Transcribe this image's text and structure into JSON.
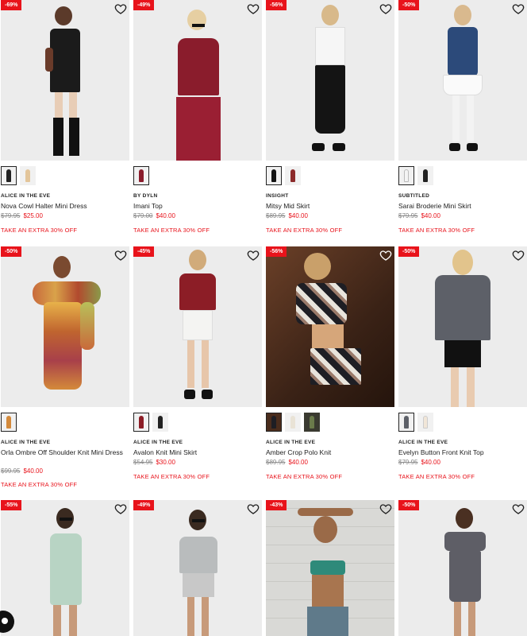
{
  "colors": {
    "sale_red": "#e8131b",
    "text_dark": "#222222",
    "strike_grey": "#888888"
  },
  "products": [
    {
      "badge": "-69%",
      "brand": "ALICE IN THE EVE",
      "name": "Nova Cowl Halter Mini Dress",
      "was": "$79.95",
      "now": "$25.00",
      "promo": "TAKE AN EXTRA 30% OFF",
      "swatches": 2
    },
    {
      "badge": "-49%",
      "brand": "BY DYLN",
      "name": "Imani Top",
      "was": "$79.00",
      "now": "$40.00",
      "promo": "TAKE AN EXTRA 30% OFF",
      "swatches": 1
    },
    {
      "badge": "-56%",
      "brand": "INSIGHT",
      "name": "Mitsy Mid Skirt",
      "was": "$89.95",
      "now": "$40.00",
      "promo": "TAKE AN EXTRA 30% OFF",
      "swatches": 2
    },
    {
      "badge": "-50%",
      "brand": "SUBTITLED",
      "name": "Sarai Broderie Mini Skirt",
      "was": "$79.95",
      "now": "$40.00",
      "promo": "TAKE AN EXTRA 30% OFF",
      "swatches": 2
    },
    {
      "badge": "-50%",
      "brand": "ALICE IN THE EVE",
      "name": "Orla Ombre Off Shoulder Knit Mini Dress",
      "was": "$99.95",
      "now": "$40.00",
      "promo": "TAKE AN EXTRA 30% OFF",
      "swatches": 1
    },
    {
      "badge": "-45%",
      "brand": "ALICE IN THE EVE",
      "name": "Avalon Knit Mini Skirt",
      "was": "$54.95",
      "now": "$30.00",
      "promo": "TAKE AN EXTRA 30% OFF",
      "swatches": 2
    },
    {
      "badge": "-56%",
      "brand": "ALICE IN THE EVE",
      "name": "Amber Crop Polo Knit",
      "was": "$89.95",
      "now": "$40.00",
      "promo": "TAKE AN EXTRA 30% OFF",
      "swatches": 3
    },
    {
      "badge": "-50%",
      "brand": "ALICE IN THE EVE",
      "name": "Evelyn Button Front Knit Top",
      "was": "$79.95",
      "now": "$40.00",
      "promo": "TAKE AN EXTRA 30% OFF",
      "swatches": 2
    },
    {
      "badge": "-55%"
    },
    {
      "badge": "-49%"
    },
    {
      "badge": "-43%"
    },
    {
      "badge": "-50%"
    }
  ]
}
